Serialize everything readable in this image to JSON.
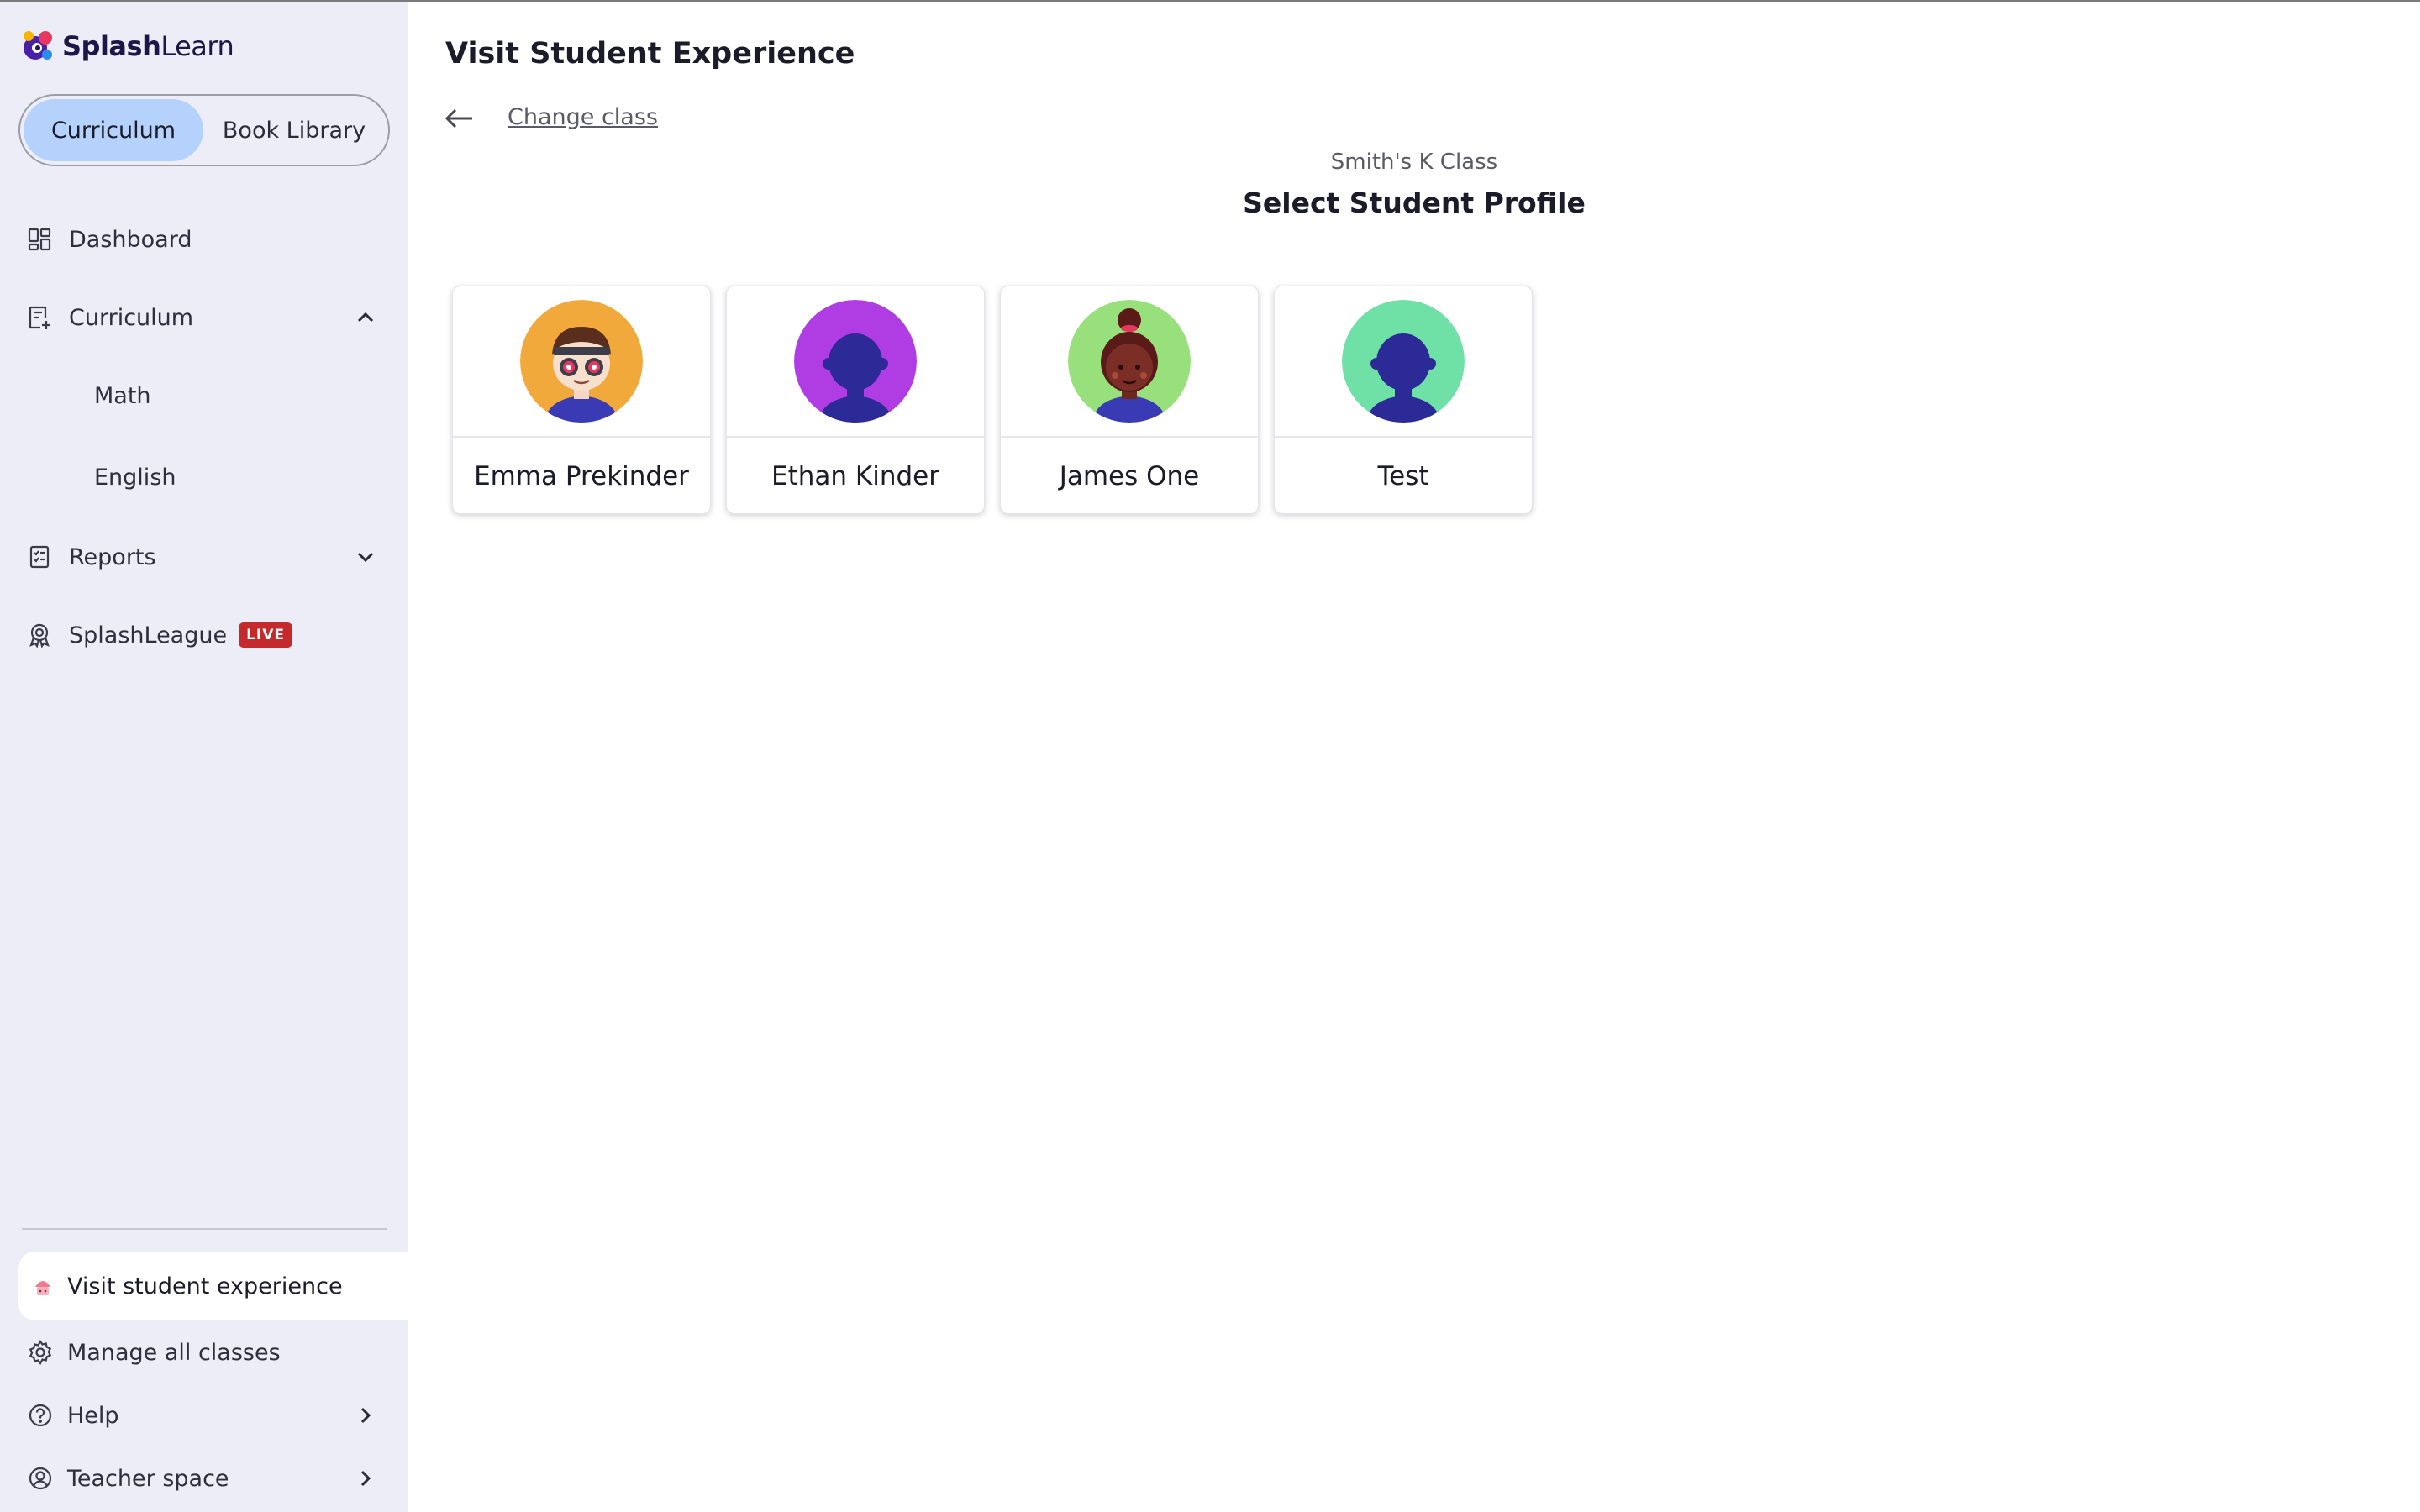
{
  "brand": {
    "name_bold": "Splash",
    "name_regular": "Learn"
  },
  "toggle": {
    "curriculum": "Curriculum",
    "book_library": "Book Library"
  },
  "nav": {
    "dashboard": "Dashboard",
    "curriculum": "Curriculum",
    "math": "Math",
    "english": "English",
    "reports": "Reports",
    "splashleague": "SplashLeague",
    "live_badge": "LIVE"
  },
  "bottom": {
    "visit": "Visit student experience",
    "manage": "Manage all classes",
    "help": "Help",
    "teacher": "Teacher space"
  },
  "main": {
    "title": "Visit Student Experience",
    "change_class": "Change class",
    "class_name": "Smith's K Class",
    "select_title": "Select Student Profile"
  },
  "students": [
    {
      "name": "Emma Prekinder",
      "avatar": "boy-with-goggles-icon",
      "color": "#f2a93b"
    },
    {
      "name": "Ethan Kinder",
      "avatar": "default-silhouette-icon",
      "color": "#b03de3"
    },
    {
      "name": "James One",
      "avatar": "girl-with-bun-icon",
      "color": "#97e07b"
    },
    {
      "name": "Test",
      "avatar": "default-silhouette-icon",
      "color": "#6fe0a6"
    }
  ],
  "colors": {
    "sidebar_bg": "#ecedf7",
    "toggle_active": "#b4d2fb",
    "live_badge": "#c4292c"
  }
}
